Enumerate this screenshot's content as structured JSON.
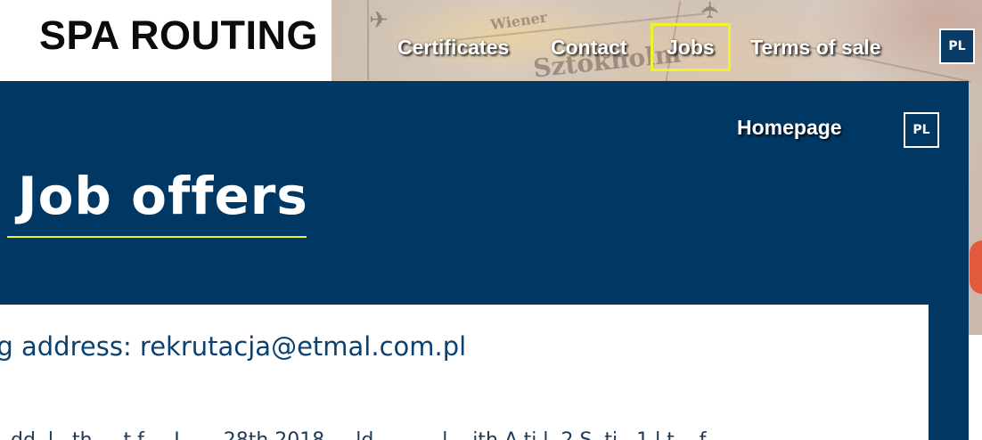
{
  "header": {
    "logo": "SPA ROUTING",
    "nav": [
      {
        "label": "Certificates"
      },
      {
        "label": "Contact"
      },
      {
        "label": "Jobs",
        "active": true
      },
      {
        "label": "Terms of sale"
      }
    ],
    "lang_label": "PL"
  },
  "map": {
    "words": [
      "Wiener",
      "Sztokholm"
    ]
  },
  "panel": {
    "home_link": "Homepage",
    "lang_label": "PL",
    "title": "Job offers"
  },
  "content": {
    "address": "ng address: rekrutacja@etmal.com.pl",
    "body_fragment": "..dd..l...th.....t.f.....J.......28th.2018.....ld....... ...l....ith.A.ti.l..2.S..ti...1.l.t....f"
  },
  "colors": {
    "panel_blue": "#003763",
    "accent_yellow": "#f0f230",
    "text_blue": "#0b4170"
  }
}
